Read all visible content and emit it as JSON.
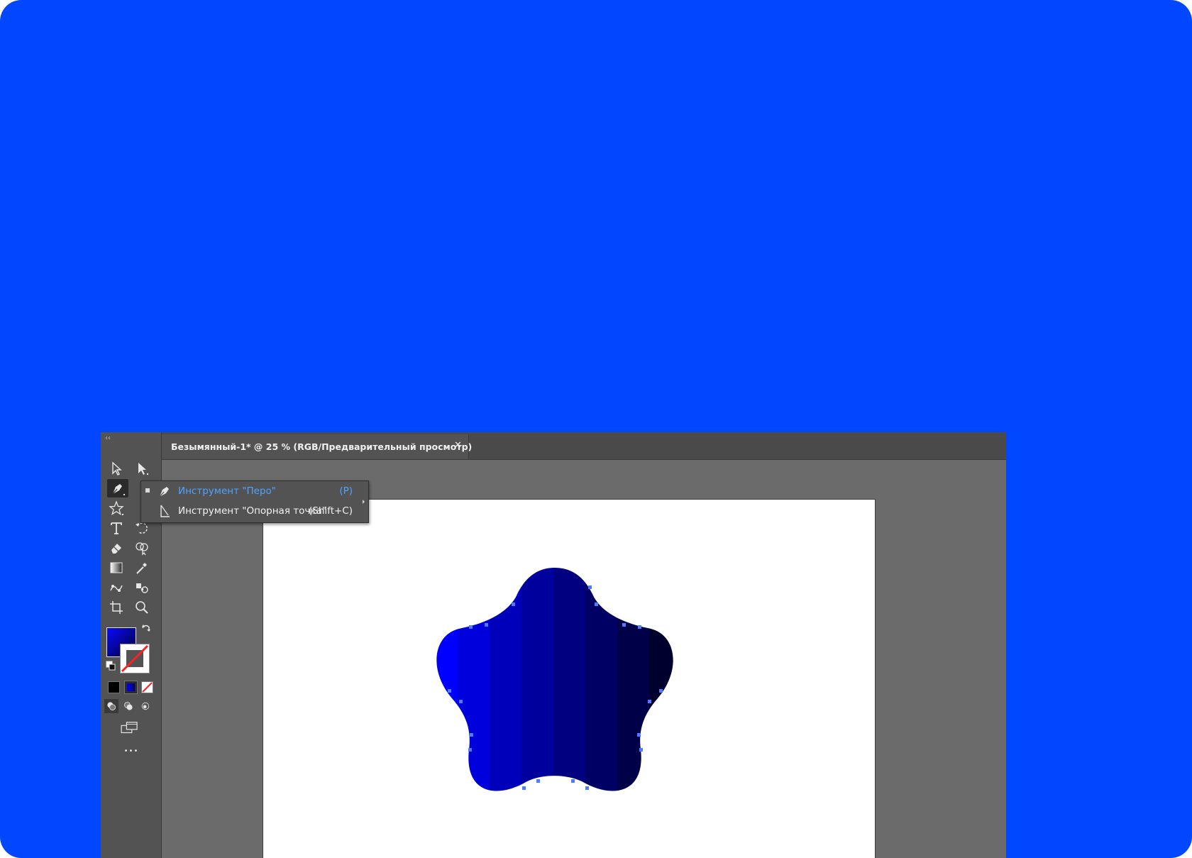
{
  "app": {
    "document_tab": {
      "title": "Безымянный-1* @ 25 % (RGB/Предварительный просмотр)",
      "close_glyph": "✕"
    },
    "toolbar": {
      "collapse_glyph": "‹‹",
      "more_glyph": "•••",
      "tools": [
        {
          "name": "selection-tool",
          "icon": "arrow-outline-icon"
        },
        {
          "name": "direct-selection-tool",
          "icon": "arrow-filled-icon"
        },
        {
          "name": "pen-tool",
          "icon": "pen-icon",
          "active": true
        },
        {
          "name": "star-tool",
          "icon": "star-icon"
        },
        {
          "name": "type-tool",
          "icon": "type-icon"
        },
        {
          "name": "rotate-tool",
          "icon": "rotate-icon"
        },
        {
          "name": "eraser-tool",
          "icon": "eraser-icon"
        },
        {
          "name": "shape-builder-tool",
          "icon": "shape-builder-icon"
        },
        {
          "name": "gradient-tool",
          "icon": "gradient-icon"
        },
        {
          "name": "eyedropper-tool",
          "icon": "eyedropper-icon"
        },
        {
          "name": "puppet-warp-tool",
          "icon": "puppet-warp-icon"
        },
        {
          "name": "symbol-sprayer-tool",
          "icon": "symbol-sprayer-icon"
        },
        {
          "name": "artboard-tool",
          "icon": "artboard-icon"
        },
        {
          "name": "zoom-tool",
          "icon": "zoom-icon"
        }
      ],
      "fill_colors": [
        "#0a0aff",
        "#000033"
      ],
      "accent": "#0000cc"
    },
    "flyout": {
      "items": [
        {
          "label": "Инструмент \"Перо\"",
          "shortcut": "(P)",
          "highlighted": true
        },
        {
          "label": "Инструмент \"Опорная точка\"",
          "shortcut": "(Shift+C)",
          "highlighted": false
        }
      ],
      "highlight_color": "#4ea3ff",
      "text_color": "#f2f2f2"
    },
    "canvas": {
      "shape": "rounded-star",
      "gradient_colors": [
        "#0000ff",
        "#0000dd",
        "#0000b8",
        "#00009a",
        "#00007d",
        "#000060",
        "#000045",
        "#00002a",
        "#000015"
      ],
      "anchor_color": "#4a7dff"
    }
  }
}
